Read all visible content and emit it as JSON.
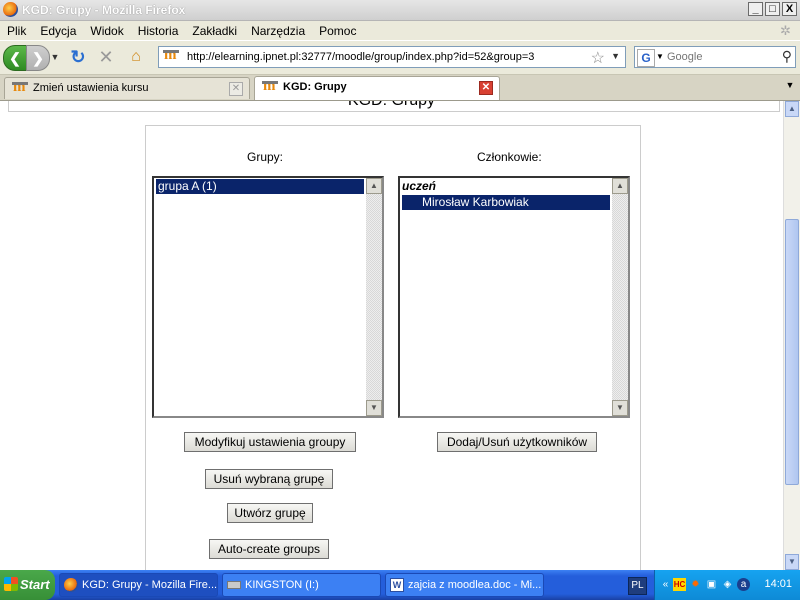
{
  "window": {
    "title": "KGD: Grupy - Mozilla Firefox",
    "buttons": [
      "_",
      "□",
      "X"
    ]
  },
  "menu": [
    "Plik",
    "Edycja",
    "Widok",
    "Historia",
    "Zakładki",
    "Narzędzia",
    "Pomoc"
  ],
  "navbar": {
    "url": "http://elearning.ipnet.pl:32777/moodle/group/index.php?id=52&group=3",
    "search_placeholder": "Google",
    "search_engine": "G"
  },
  "tabs": [
    {
      "label": "Zmień ustawienia kursu",
      "active": false
    },
    {
      "label": "KGD: Grupy",
      "active": true
    }
  ],
  "page": {
    "heading": "KGD: Grupy",
    "groups_label": "Grupy:",
    "members_label": "Członkowie:",
    "groups": [
      {
        "label": "grupa A (1)",
        "selected": true
      }
    ],
    "members_role": "uczeń",
    "members": [
      {
        "label": "Mirosław Karbowiak",
        "selected": true
      }
    ],
    "buttons": {
      "edit_group": "Modyfikuj ustawienia groupy",
      "delete_group": "Usuń wybraną grupę",
      "create_group": "Utwórz grupę",
      "auto_create": "Auto-create groups",
      "add_remove_users": "Dodaj/Usuń użytkowników"
    }
  },
  "taskbar": {
    "start": "Start",
    "tasks": [
      {
        "label": "KGD: Grupy - Mozilla Fire...",
        "active": true
      },
      {
        "label": "KINGSTON (I:)",
        "active": false
      },
      {
        "label": "zajcia z moodlea.doc - Mi...",
        "active": false
      }
    ],
    "language": "PL",
    "clock": "14:01"
  },
  "colors": {
    "selection": "#0a246a",
    "taskbar": "#245edb",
    "tray": "#0e8ad6"
  }
}
